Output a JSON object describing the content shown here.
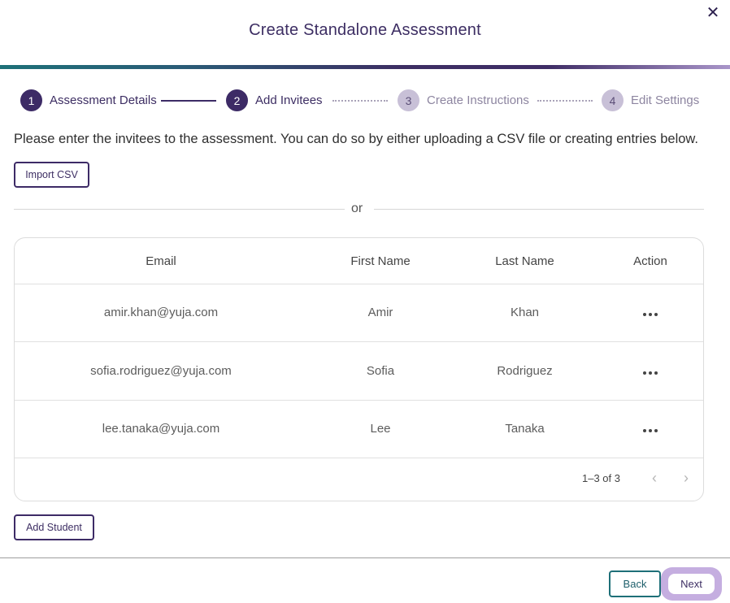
{
  "dialog": {
    "title": "Create Standalone Assessment",
    "close_symbol": "✕"
  },
  "stepper": {
    "steps": [
      {
        "number": "1",
        "label": "Assessment Details",
        "state": "active"
      },
      {
        "number": "2",
        "label": "Add Invitees",
        "state": "active"
      },
      {
        "number": "3",
        "label": "Create Instructions",
        "state": "inactive"
      },
      {
        "number": "4",
        "label": "Edit Settings",
        "state": "inactive"
      }
    ]
  },
  "intro_text": "Please enter the invitees to the assessment. You can do so by either uploading a CSV file or creating entries below.",
  "import_csv_label": "Import CSV",
  "or_text": "or",
  "table": {
    "headers": {
      "email": "Email",
      "first": "First Name",
      "last": "Last Name",
      "action": "Action"
    },
    "rows": [
      {
        "email": "amir.khan@yuja.com",
        "first": "Amir",
        "last": "Khan"
      },
      {
        "email": "sofia.rodriguez@yuja.com",
        "first": "Sofia",
        "last": "Rodriguez"
      },
      {
        "email": "lee.tanaka@yuja.com",
        "first": "Lee",
        "last": "Tanaka"
      }
    ],
    "pagination": {
      "range": "1–3 of 3",
      "prev_symbol": "‹",
      "next_symbol": "›"
    }
  },
  "add_student_label": "Add Student",
  "footer": {
    "back_label": "Back",
    "next_label": "Next"
  },
  "colors": {
    "primary": "#3d2b66",
    "teal": "#1e6f78",
    "highlight": "#c5aee0"
  }
}
